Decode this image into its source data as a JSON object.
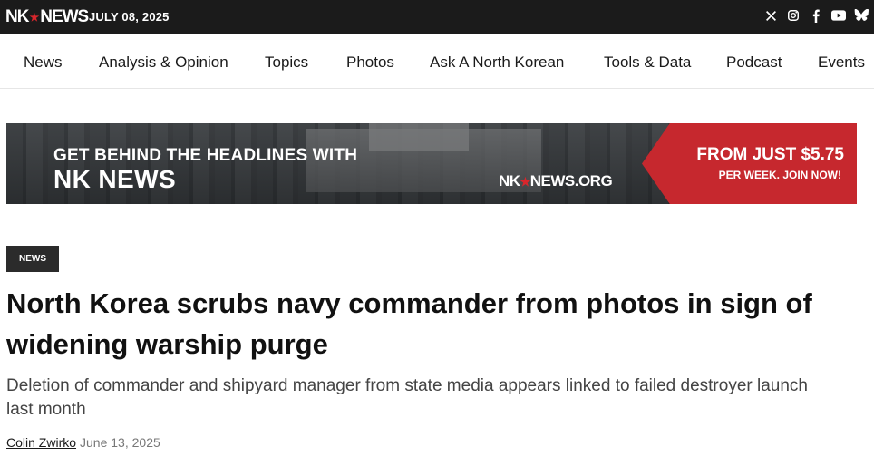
{
  "header": {
    "logo_text_left": "NK",
    "logo_text_right": "NEWS",
    "date": "JULY 08, 2025",
    "social_icons": [
      "x-icon",
      "instagram-icon",
      "facebook-icon",
      "youtube-icon",
      "bluesky-icon"
    ]
  },
  "nav": {
    "items": [
      "News",
      "Analysis & Opinion",
      "Topics",
      "Photos",
      "Ask A North Korean",
      "Tools & Data",
      "Podcast",
      "Events"
    ]
  },
  "banner": {
    "line1": "GET BEHIND THE HEADLINES WITH",
    "line2": "NK NEWS",
    "site_left": "NK",
    "site_right": "NEWS.ORG",
    "price": "FROM JUST $5.75",
    "cta": "PER WEEK. JOIN NOW!"
  },
  "article": {
    "category": "NEWS",
    "headline": "North Korea scrubs navy commander from photos in sign of widening warship purge",
    "subheadline": "Deletion of commander and shipyard manager from state media appears linked to failed destroyer launch last month",
    "author": "Colin Zwirko",
    "date": "June 13, 2025"
  },
  "colors": {
    "topbar": "#1b1b1b",
    "accent_red": "#c6282e",
    "tag_bg": "#2b2b2b"
  }
}
